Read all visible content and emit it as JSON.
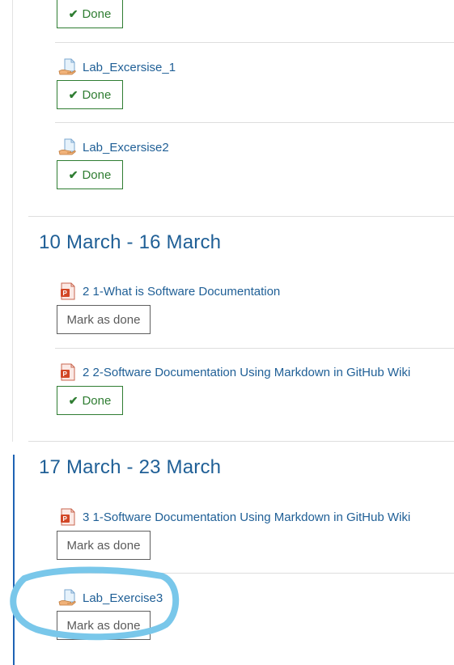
{
  "top_item": {
    "status_label": "Done"
  },
  "section_prev": {
    "items": [
      {
        "icon": "file-hand-icon",
        "title": "Lab_Excersise_1",
        "status_label": "Done"
      },
      {
        "icon": "file-hand-icon",
        "title": "Lab_Excersise2",
        "status_label": "Done"
      }
    ]
  },
  "section_mar10": {
    "title": "10 March - 16 March",
    "items": [
      {
        "icon": "powerpoint-icon",
        "title": "2 1-What is Software Documentation",
        "status_label": "Mark as done"
      },
      {
        "icon": "powerpoint-icon",
        "title": "2 2-Software Documentation Using Markdown in GitHub Wiki",
        "status_label": "Done"
      }
    ]
  },
  "section_mar17": {
    "title": "17 March - 23 March",
    "items": [
      {
        "icon": "powerpoint-icon",
        "title": "3 1-Software Documentation Using Markdown in GitHub Wiki",
        "status_label": "Mark as done"
      },
      {
        "icon": "file-hand-icon",
        "title": "Lab_Exercise3",
        "status_label": "Mark as done"
      }
    ]
  },
  "colors": {
    "link": "#1f5f96",
    "done": "#2f7d32",
    "current_section_bar": "#1e63b4",
    "annotation": "#79c7ea"
  },
  "check_glyph": "✔"
}
